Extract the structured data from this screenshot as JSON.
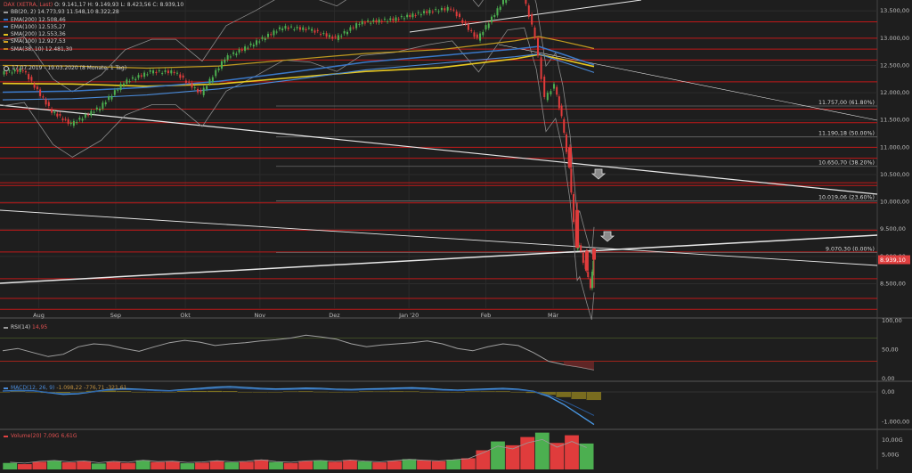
{
  "chart_data": [
    {
      "type": "candlestick",
      "title": "DAX (XETRA, Last)",
      "ohlc_header": {
        "open": "O: 9.141,17",
        "high": "H: 9.149,93",
        "low": "L: 8.423,56",
        "close": "C: 8.939,10"
      },
      "range_label": "17.07.2019 - 19.03.2020",
      "range_detail": "(8 Monate, 1 Tag)",
      "ylim": [
        8050,
        13700
      ],
      "y_ticks": [
        13500,
        13000,
        12500,
        12000,
        11500,
        11000,
        10500,
        10000,
        9500,
        9000,
        8500
      ],
      "y_tick_labels": [
        "13.500,00",
        "13.000,00",
        "12.500,00",
        "12.000,00",
        "11.500,00",
        "11.000,00",
        "10.500,00",
        "10.000,00",
        "9.500,00",
        "9.000,00",
        "8.500,00"
      ],
      "x_ticks": [
        {
          "label": "Aug",
          "date": "2019-08-01"
        },
        {
          "label": "Sep",
          "date": "2019-09-02"
        },
        {
          "label": "Okt",
          "date": "2019-10-01"
        },
        {
          "label": "Nov",
          "date": "2019-11-01"
        },
        {
          "label": "Dez",
          "date": "2019-12-02"
        },
        {
          "label": "Jan '20",
          "date": "2020-01-02"
        },
        {
          "label": "Feb",
          "date": "2020-02-03"
        },
        {
          "label": "Mär",
          "date": "2020-03-02"
        }
      ],
      "last_price": {
        "value": 8939.1,
        "label": "8.939,10",
        "color": "#e04040"
      },
      "indicators": [
        {
          "name": "BB(20, 2)",
          "values": "14.773,93  11.548,10  8.322,28",
          "color": "#9a9a9a"
        },
        {
          "name": "EMA(200)",
          "values": "12.508,46",
          "color": "#3a78c8"
        },
        {
          "name": "EMA(100)",
          "values": "12.535,27",
          "color": "#4a8ad8"
        },
        {
          "name": "SMA(200)",
          "values": "12.553,36",
          "color": "#e0c020"
        },
        {
          "name": "SMA(100)",
          "values": "12.927,53",
          "color": "#d0a020"
        },
        {
          "name": "SMA(38, 10)",
          "values": "12.481,30",
          "color": "#c08020"
        }
      ],
      "fibonacci": [
        {
          "label": "11.757,00 (61.80%)",
          "value": 11757.0
        },
        {
          "label": "11.190,18 (50.00%)",
          "value": 11190.18
        },
        {
          "label": "10.650,70 (38.20%)",
          "value": 10650.7
        },
        {
          "label": "10.019,06 (23.60%)",
          "value": 10019.06
        },
        {
          "label": "9.070,30 (0.00%)",
          "value": 9070.3
        }
      ],
      "support_resistance_levels": [
        13300,
        13000,
        12800,
        12600,
        12200,
        11700,
        11450,
        11000,
        10800,
        10350,
        10300,
        9980,
        9480,
        9080,
        8590,
        8230,
        8030
      ],
      "level_color": "#c01818",
      "sma_series": [
        {
          "date": "2019-07-17",
          "value": 12170
        },
        {
          "date": "2019-08-15",
          "value": 12160
        },
        {
          "date": "2019-09-15",
          "value": 12120
        },
        {
          "date": "2019-10-15",
          "value": 12160
        },
        {
          "date": "2019-11-15",
          "value": 12280
        },
        {
          "date": "2019-12-15",
          "value": 12390
        },
        {
          "date": "2020-01-15",
          "value": 12460
        },
        {
          "date": "2020-02-15",
          "value": 12620
        },
        {
          "date": "2020-02-25",
          "value": 12700
        },
        {
          "date": "2020-03-05",
          "value": 12620
        },
        {
          "date": "2020-03-19",
          "value": 12480
        }
      ],
      "ema_series": [
        {
          "date": "2019-07-17",
          "value": 12010
        },
        {
          "date": "2019-08-15",
          "value": 12030
        },
        {
          "date": "2019-09-15",
          "value": 12100
        },
        {
          "date": "2019-10-15",
          "value": 12210
        },
        {
          "date": "2019-11-15",
          "value": 12380
        },
        {
          "date": "2019-12-15",
          "value": 12560
        },
        {
          "date": "2020-01-15",
          "value": 12680
        },
        {
          "date": "2020-02-15",
          "value": 12800
        },
        {
          "date": "2020-02-25",
          "value": 12850
        },
        {
          "date": "2020-03-05",
          "value": 12720
        },
        {
          "date": "2020-03-19",
          "value": 12510
        }
      ],
      "close_series": [
        {
          "date": "2019-07-17",
          "value": 12360
        },
        {
          "date": "2019-07-26",
          "value": 12420
        },
        {
          "date": "2019-08-07",
          "value": 11650
        },
        {
          "date": "2019-08-15",
          "value": 11420
        },
        {
          "date": "2019-08-27",
          "value": 11730
        },
        {
          "date": "2019-09-06",
          "value": 12190
        },
        {
          "date": "2019-09-17",
          "value": 12380
        },
        {
          "date": "2019-09-27",
          "value": 12380
        },
        {
          "date": "2019-10-08",
          "value": 11980
        },
        {
          "date": "2019-10-18",
          "value": 12630
        },
        {
          "date": "2019-10-30",
          "value": 12900
        },
        {
          "date": "2019-11-11",
          "value": 13200
        },
        {
          "date": "2019-11-22",
          "value": 13160
        },
        {
          "date": "2019-12-03",
          "value": 12990
        },
        {
          "date": "2019-12-13",
          "value": 13280
        },
        {
          "date": "2019-12-27",
          "value": 13340
        },
        {
          "date": "2020-01-10",
          "value": 13480
        },
        {
          "date": "2020-01-20",
          "value": 13550
        },
        {
          "date": "2020-01-31",
          "value": 12980
        },
        {
          "date": "2020-02-12",
          "value": 13750
        },
        {
          "date": "2020-02-19",
          "value": 13790
        },
        {
          "date": "2020-02-24",
          "value": 13030
        },
        {
          "date": "2020-02-28",
          "value": 11890
        },
        {
          "date": "2020-03-03",
          "value": 12130
        },
        {
          "date": "2020-03-06",
          "value": 11540
        },
        {
          "date": "2020-03-09",
          "value": 10630
        },
        {
          "date": "2020-03-12",
          "value": 9160
        },
        {
          "date": "2020-03-13",
          "value": 9230
        },
        {
          "date": "2020-03-16",
          "value": 8740
        },
        {
          "date": "2020-03-18",
          "value": 8440
        },
        {
          "date": "2020-03-19",
          "value": 8939
        }
      ],
      "big_red_candles": [
        {
          "date": "2020-03-09",
          "open": 11000,
          "high": 11050,
          "low": 10600,
          "close": 10630
        },
        {
          "date": "2020-03-12",
          "open": 9850,
          "high": 9990,
          "low": 9150,
          "close": 9160
        },
        {
          "date": "2020-03-16",
          "open": 9100,
          "high": 9140,
          "low": 8700,
          "close": 8740
        },
        {
          "date": "2020-03-19",
          "open": 9141.17,
          "high": 9149.93,
          "low": 8423.56,
          "close": 8939.1
        }
      ]
    },
    {
      "type": "line",
      "title": "RSI(14)",
      "value_label": "14,95",
      "ylim": [
        0,
        100
      ],
      "y_tick_labels": [
        "100,00",
        "50,00",
        "0,00"
      ],
      "y_ticks": [
        100,
        50,
        0
      ],
      "series": [
        {
          "values": [
            48,
            52,
            45,
            38,
            42,
            55,
            60,
            58,
            52,
            47,
            55,
            62,
            66,
            63,
            57,
            60,
            62,
            65,
            67,
            70,
            75,
            72,
            68,
            60,
            55,
            58,
            60,
            62,
            65,
            60,
            52,
            48,
            55,
            60,
            57,
            45,
            30,
            24,
            20,
            15
          ]
        }
      ]
    },
    {
      "type": "line",
      "title": "MACD(12, 26, 9)",
      "value_label": "-1.098,22  -776,71  -321,61",
      "ylim": [
        -1200,
        300
      ],
      "y_tick_labels": [
        "0,00",
        "-1.000,00"
      ],
      "y_ticks": [
        0,
        -1000
      ],
      "series": [
        {
          "values": [
            30,
            50,
            40,
            -20,
            -80,
            -60,
            10,
            80,
            110,
            90,
            60,
            40,
            80,
            120,
            160,
            180,
            150,
            120,
            100,
            110,
            130,
            120,
            90,
            80,
            100,
            110,
            130,
            140,
            120,
            80,
            60,
            80,
            100,
            120,
            90,
            20,
            -150,
            -420,
            -760,
            -1098
          ]
        }
      ]
    },
    {
      "type": "bar",
      "title": "Volume(20)",
      "value_label": "7,09G  6,61G",
      "ylim": [
        0,
        13000
      ],
      "y_tick_labels": [
        "10,00G",
        "5,00G"
      ],
      "y_ticks": [
        10000,
        5000
      ],
      "series": [
        {
          "values": [
            2200,
            1800,
            2600,
            3000,
            2400,
            2800,
            2000,
            2600,
            2200,
            3100,
            2500,
            2700,
            2100,
            2300,
            2900,
            2400,
            2600,
            3300,
            2500,
            2200,
            2800,
            3000,
            2600,
            3200,
            2700,
            2400,
            2900,
            3500,
            3100,
            2800,
            3300,
            3800,
            6500,
            9500,
            8200,
            11000,
            12500,
            9000,
            11600,
            8800
          ]
        }
      ]
    }
  ]
}
